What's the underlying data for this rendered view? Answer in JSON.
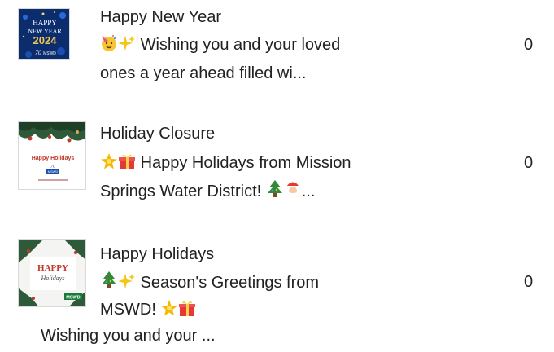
{
  "posts": [
    {
      "title": "Happy New Year",
      "line1": "Wishing you and your loved",
      "line2": "ones a year ahead filled wi...",
      "count": "0",
      "thumb": {
        "l1": "HAPPY",
        "l2": "NEW YEAR",
        "l3": "2024",
        "badge": "MSWD"
      }
    },
    {
      "title": "Holiday Closure",
      "line1": "Happy Holidays from Mission",
      "line2": "Springs Water District!",
      "line2_tail": "...",
      "count": "0",
      "thumb": {
        "l1": "Happy Holidays",
        "badge": "MSWD"
      }
    },
    {
      "title": "Happy Holidays",
      "line1": "Season's Greetings from",
      "line2": "MSWD!",
      "line3": "Wishing you and your ...",
      "count": "0",
      "thumb": {
        "l1": "HAPPY",
        "l2": "Holidays",
        "badge": "MSWD"
      }
    }
  ]
}
